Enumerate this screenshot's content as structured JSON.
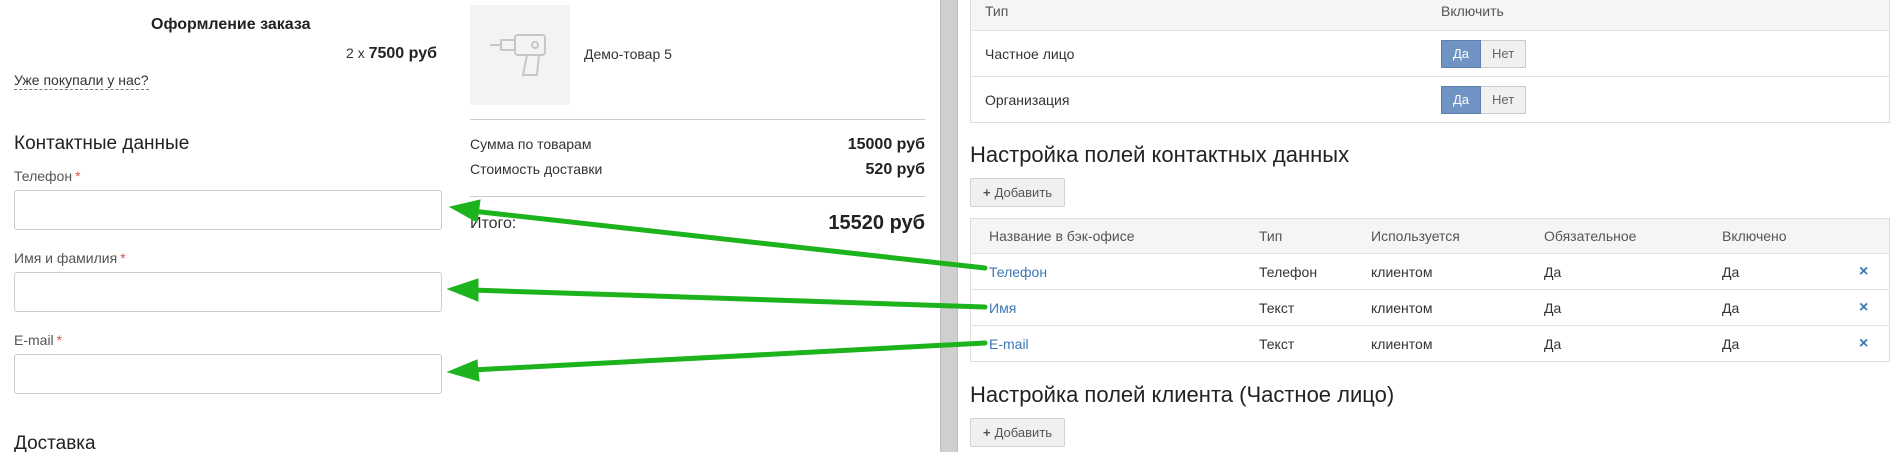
{
  "checkout": {
    "title": "Оформление заказа",
    "already_bought_link": "Уже покупали у нас?",
    "contact_section": "Контактные данные",
    "fields": [
      {
        "label": "Телефон",
        "required": "*"
      },
      {
        "label": "Имя и фамилия",
        "required": "*"
      },
      {
        "label": "E-mail",
        "required": "*"
      }
    ],
    "delivery_section": "Доставка"
  },
  "cart": {
    "product_name": "Демо-товар 5",
    "qty_prefix": "2 x",
    "price": "7500 руб",
    "goods_sum_label": "Сумма по товарам",
    "goods_sum_value": "15000 руб",
    "delivery_label": "Стоимость доставки",
    "delivery_value": "520 руб",
    "total_label": "Итого:",
    "total_value": "15520 руб"
  },
  "admin": {
    "type_table": {
      "headers": [
        "Тип",
        "Включить"
      ],
      "rows": [
        {
          "type": "Частное лицо",
          "yes": "Да",
          "no": "Нет",
          "active": "yes"
        },
        {
          "type": "Организация",
          "yes": "Да",
          "no": "Нет",
          "active": "yes"
        }
      ]
    },
    "contact_fields_title": "Настройка полей контактных данных",
    "add_label": "Добавить",
    "fields_table": {
      "headers": [
        "Название в бэк-офисе",
        "Тип",
        "Используется",
        "Обязательное",
        "Включено"
      ],
      "rows": [
        {
          "name": "Телефон",
          "type": "Телефон",
          "used": "клиентом",
          "required": "Да",
          "enabled": "Да"
        },
        {
          "name": "Имя",
          "type": "Текст",
          "used": "клиентом",
          "required": "Да",
          "enabled": "Да"
        },
        {
          "name": "E-mail",
          "type": "Текст",
          "used": "клиентом",
          "required": "Да",
          "enabled": "Да"
        }
      ],
      "delete_icon": "×"
    },
    "client_fields_title": "Настройка полей клиента (Частное лицо)",
    "add_label_2": "Добавить"
  },
  "colors": {
    "arrow": "#1db31d",
    "accent": "#6f93c2",
    "link": "#3c78b5"
  }
}
